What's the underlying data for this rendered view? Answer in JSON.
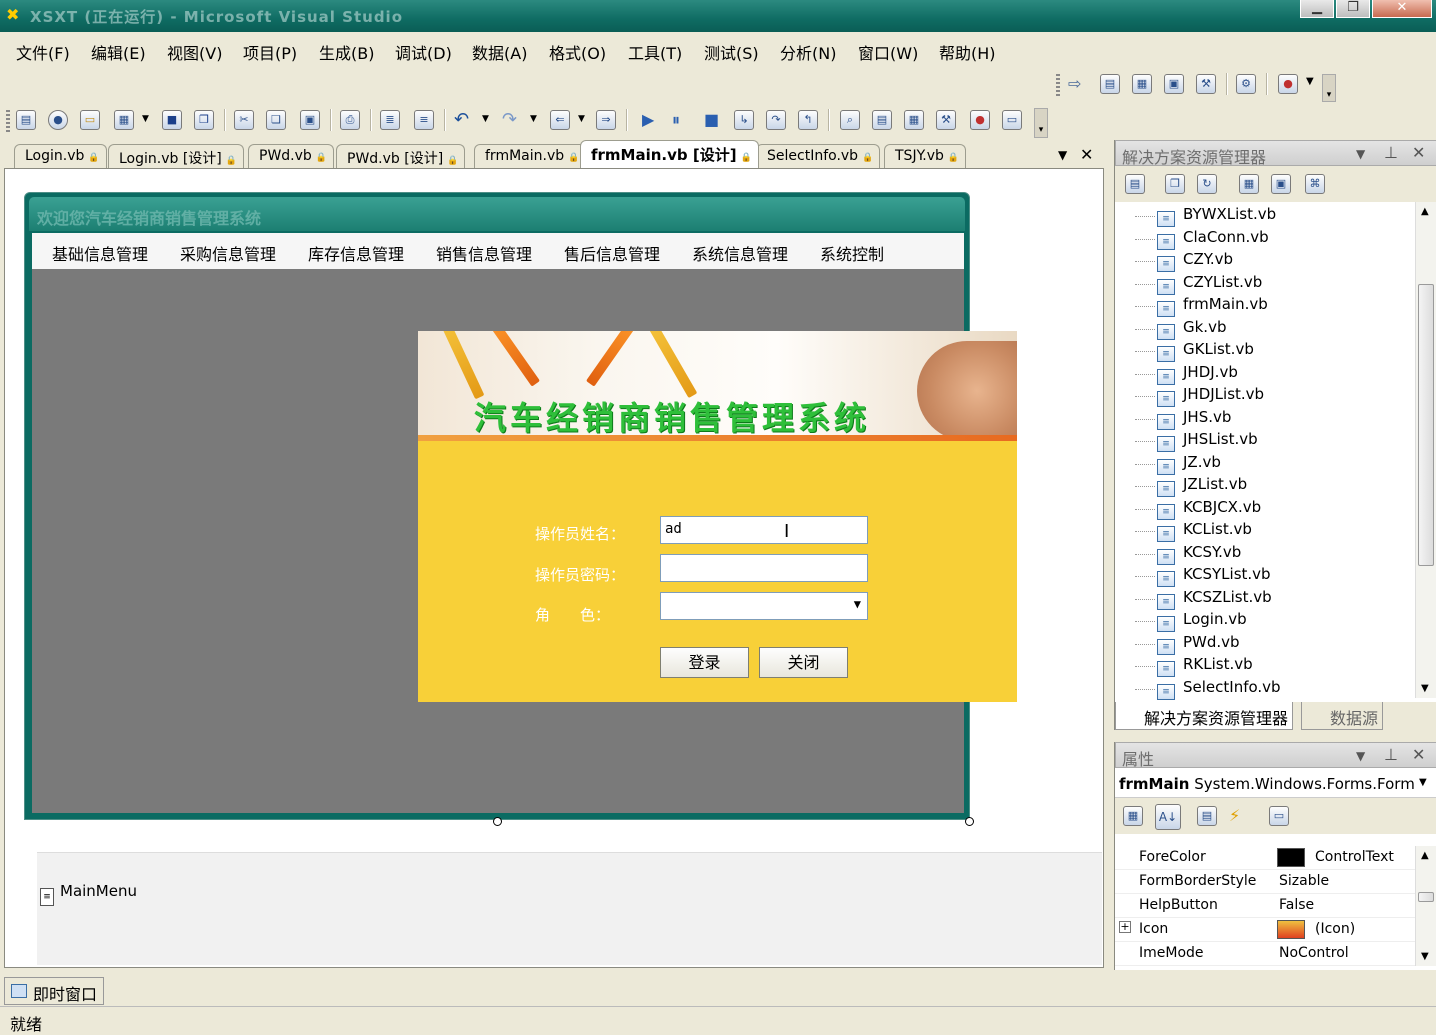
{
  "window": {
    "title": "XSXT (正在运行) - Microsoft Visual Studio"
  },
  "menu": [
    "文件(F)",
    "编辑(E)",
    "视图(V)",
    "项目(P)",
    "生成(B)",
    "调试(D)",
    "数据(A)",
    "格式(O)",
    "工具(T)",
    "测试(S)",
    "分析(N)",
    "窗口(W)",
    "帮助(H)"
  ],
  "tabs": [
    {
      "label": "Login.vb",
      "active": false
    },
    {
      "label": "Login.vb [设计]",
      "active": false
    },
    {
      "label": "PWd.vb",
      "active": false
    },
    {
      "label": "PWd.vb [设计]",
      "active": false
    },
    {
      "label": "frmMain.vb",
      "active": false
    },
    {
      "label": "frmMain.vb [设计]",
      "active": true
    },
    {
      "label": "SelectInfo.vb",
      "active": false
    },
    {
      "label": "TSJY.vb",
      "active": false
    }
  ],
  "form": {
    "title": "欢迎您汽车经销商销售管理系统",
    "menu": [
      "基础信息管理",
      "采购信息管理",
      "库存信息管理",
      "销售信息管理",
      "售后信息管理",
      "系统信息管理",
      "系统控制"
    ]
  },
  "login": {
    "banner_title": "汽车经销商销售管理系统",
    "username_label": "操作员姓名：",
    "username_value": "ad",
    "password_label": "操作员密码：",
    "password_value": "",
    "role_label": "角　　色：",
    "role_value": "",
    "login_button": "登录",
    "close_button": "关闭"
  },
  "tray": {
    "component": "MainMenu"
  },
  "solution_explorer": {
    "title": "解决方案资源管理器",
    "files": [
      "BYWXList.vb",
      "ClaConn.vb",
      "CZY.vb",
      "CZYList.vb",
      "frmMain.vb",
      "Gk.vb",
      "GKList.vb",
      "JHDJ.vb",
      "JHDJList.vb",
      "JHS.vb",
      "JHSList.vb",
      "JZ.vb",
      "JZList.vb",
      "KCBJCX.vb",
      "KCList.vb",
      "KCSY.vb",
      "KCSYList.vb",
      "KCSZList.vb",
      "Login.vb",
      "PWd.vb",
      "RKList.vb",
      "SelectInfo.vb"
    ],
    "bottom_tabs": [
      "解决方案资源管理器",
      "数据源"
    ]
  },
  "properties": {
    "title": "属性",
    "object_name": "frmMain",
    "object_type": "System.Windows.Forms.Form",
    "rows": [
      {
        "name": "ForeColor",
        "value": "ControlText",
        "swatch": "#000000"
      },
      {
        "name": "FormBorderStyle",
        "value": "Sizable"
      },
      {
        "name": "HelpButton",
        "value": "False"
      },
      {
        "name": "Icon",
        "value": "(Icon)",
        "expandable": true
      },
      {
        "name": "ImeMode",
        "value": "NoControl"
      }
    ]
  },
  "immediate_tab": "即时窗口",
  "status": "就绪"
}
